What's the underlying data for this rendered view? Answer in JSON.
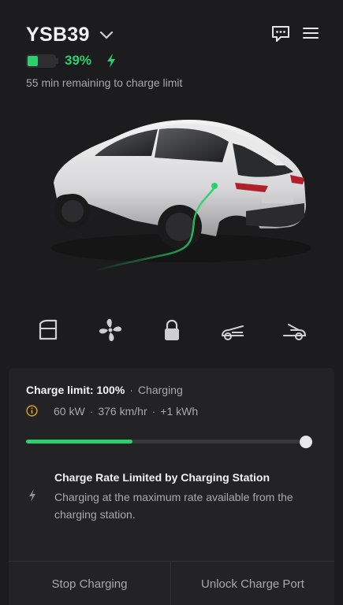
{
  "vehicle": {
    "name": "YSB39",
    "battery_percent_text": "39%",
    "battery_level": 0.39,
    "remaining_text": "55 min remaining to charge limit"
  },
  "icons": {
    "vehicle_menu": "chevron-down-icon",
    "messages": "chat-bubble-icon",
    "menu": "hamburger-menu-icon",
    "charging": "lightning-bolt-icon",
    "quick_controls": [
      "door-icon",
      "fan-icon",
      "lock-icon",
      "frunk-icon",
      "trunk-icon"
    ]
  },
  "charge": {
    "limit_label": "Charge limit: 100%",
    "status": "Charging",
    "power": "60 kW",
    "rate": "376 km/hr",
    "added": "+1 kWh",
    "current_level": 0.39,
    "limit_level": 1.0
  },
  "notice": {
    "title": "Charge Rate Limited by Charging Station",
    "body": "Charging at the maximum rate available from the charging station."
  },
  "actions": {
    "stop": "Stop Charging",
    "unlock": "Unlock Charge Port"
  },
  "colors": {
    "accent": "#2bd06d",
    "warning": "#e6a321",
    "background": "#1c1c1e",
    "panel": "#232326"
  }
}
